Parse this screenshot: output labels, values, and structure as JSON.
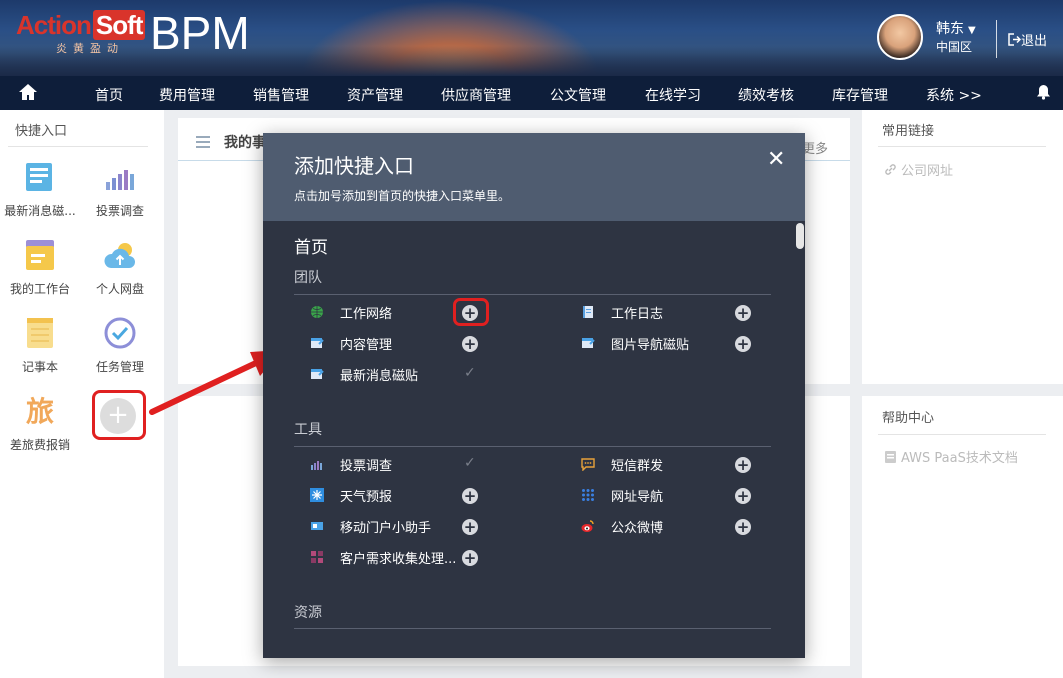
{
  "header": {
    "logo_action": "Action",
    "logo_soft": "Soft",
    "logo_sub": "炎黄盈动",
    "app_name": "BPM",
    "user_name": "韩东",
    "user_region": "中国区",
    "logout_label": "退出"
  },
  "nav": {
    "items": [
      "首页",
      "费用管理",
      "销售管理",
      "资产管理",
      "供应商管理",
      "公文管理",
      "在线学习",
      "绩效考核",
      "库存管理",
      "系统 >>"
    ]
  },
  "left_panel": {
    "title": "快捷入口",
    "items": [
      {
        "label": "最新消息磁...",
        "icon": "news-icon"
      },
      {
        "label": "投票调查",
        "icon": "vote-chart-icon"
      },
      {
        "label": "我的工作台",
        "icon": "workbench-icon"
      },
      {
        "label": "个人网盘",
        "icon": "cloud-icon"
      },
      {
        "label": "记事本",
        "icon": "notepad-icon"
      },
      {
        "label": "任务管理",
        "icon": "task-check-icon"
      },
      {
        "label": "差旅费报销",
        "icon": "travel-icon",
        "glyph": "旅"
      }
    ],
    "add_glyph": "+"
  },
  "center": {
    "tab_label": "我的事",
    "more_label": "更多"
  },
  "right": {
    "links_title": "常用链接",
    "links": [
      "公司网址"
    ],
    "help_title": "帮助中心",
    "help_links": [
      "AWS PaaS技术文档"
    ]
  },
  "modal": {
    "title": "添加快捷入口",
    "subtitle": "点击加号添加到首页的快捷入口菜单里。",
    "close_glyph": "✕",
    "page_section": "首页",
    "groups": [
      {
        "name": "团队",
        "items": [
          {
            "label": "工作网络",
            "icon": "globe-icon",
            "state": "add"
          },
          {
            "label": "工作日志",
            "icon": "log-icon",
            "state": "add"
          },
          {
            "label": "内容管理",
            "icon": "content-icon",
            "state": "add"
          },
          {
            "label": "图片导航磁贴",
            "icon": "image-nav-icon",
            "state": "add"
          },
          {
            "label": "最新消息磁贴",
            "icon": "news-tile-icon",
            "state": "added"
          }
        ]
      },
      {
        "name": "工具",
        "items": [
          {
            "label": "投票调查",
            "icon": "vote-icon",
            "state": "added"
          },
          {
            "label": "短信群发",
            "icon": "sms-icon",
            "state": "add"
          },
          {
            "label": "天气预报",
            "icon": "weather-icon",
            "state": "add"
          },
          {
            "label": "网址导航",
            "icon": "grid-icon",
            "state": "add"
          },
          {
            "label": "移动门户小助手",
            "icon": "mobile-icon",
            "state": "add"
          },
          {
            "label": "公众微博",
            "icon": "weibo-icon",
            "state": "add"
          },
          {
            "label": "客户需求收集处理...",
            "icon": "requirement-icon",
            "state": "add"
          }
        ]
      },
      {
        "name": "资源",
        "items": []
      }
    ]
  },
  "colors": {
    "nav_bg": "#0e1e3a",
    "modal_bg": "#2e3442",
    "modal_head_bg": "#4f5c70",
    "highlight": "#e02020"
  }
}
